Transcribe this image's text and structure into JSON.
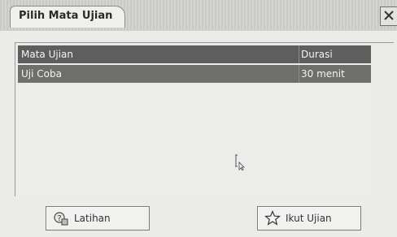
{
  "window": {
    "title": "Pilih Mata Ujian",
    "close_icon": "close-icon"
  },
  "table": {
    "columns": [
      "Mata Ujian",
      "Durasi"
    ],
    "rows": [
      {
        "subject": "Uji Coba",
        "duration": "30 menit"
      }
    ]
  },
  "buttons": {
    "latihan": "Latihan",
    "ikut_ujian": "Ikut Ujian"
  },
  "colors": {
    "header_bg": "#5e5e5e",
    "selected_row_bg": "#6e6e6c",
    "window_bg": "#ebebe8"
  }
}
